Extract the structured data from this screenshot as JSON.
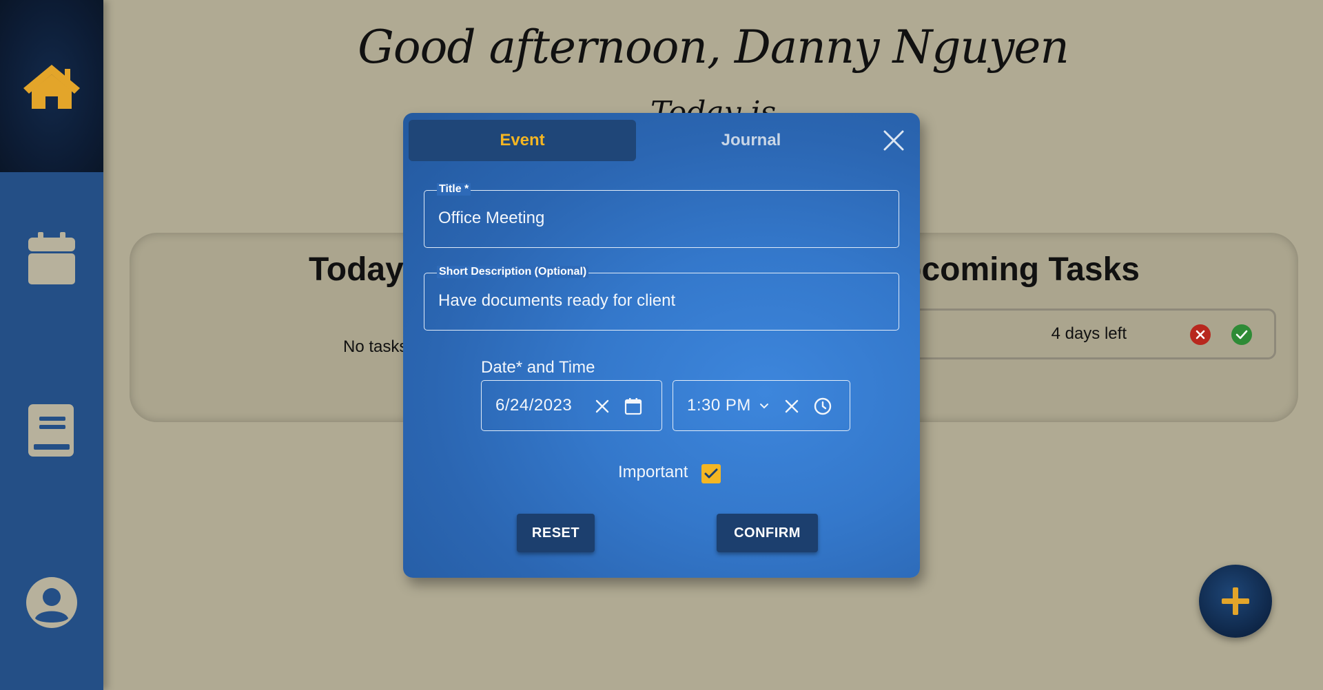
{
  "header": {
    "greeting": "Good afternoon, Danny Nguyen",
    "date_fragment": "Today is"
  },
  "sidebar": {
    "items": [
      {
        "icon": "home-icon",
        "active": true
      },
      {
        "icon": "calendar-icon",
        "active": false
      },
      {
        "icon": "journal-book-icon",
        "active": false
      },
      {
        "icon": "user-avatar-icon",
        "active": false
      }
    ]
  },
  "dashboard": {
    "today_title": "Today",
    "today_empty": "No tasks",
    "upcoming_title": "Upcoming Tasks",
    "upcoming_tasks": [
      {
        "days_left": "4 days left"
      }
    ]
  },
  "modal": {
    "tabs": {
      "event": "Event",
      "journal": "Journal"
    },
    "title_field": {
      "label": "Title *",
      "value": "Office Meeting"
    },
    "description_field": {
      "label": "Short Description (Optional)",
      "value": "Have documents ready for client"
    },
    "datetime_label": "Date* and Time",
    "date_value": "6/24/2023",
    "time_value": "1:30 PM",
    "important_label": "Important",
    "important_checked": true,
    "reset_label": "RESET",
    "confirm_label": "CONFIRM"
  },
  "colors": {
    "accent": "#f4b623",
    "sidebar": "#244f86",
    "background": "#b0aa93",
    "modal": "#3478cb"
  }
}
